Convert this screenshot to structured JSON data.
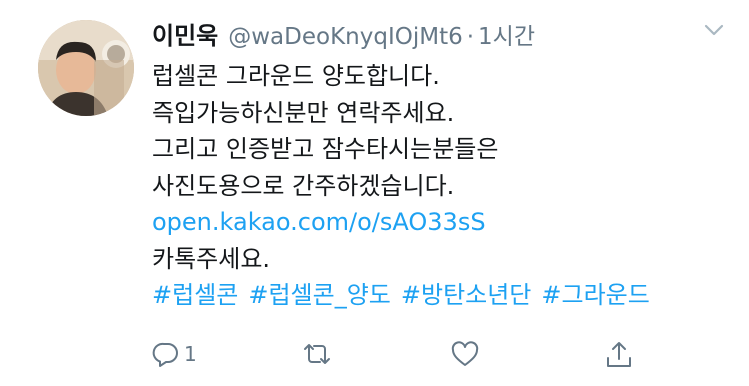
{
  "user": {
    "name": "이민욱",
    "handle": "@waDeoKnyqIOjMt6",
    "separator": "·",
    "time": "1시간"
  },
  "tweet": {
    "lines": [
      "럽셀콘 그라운드 양도합니다.",
      "즉입가능하신분만 연락주세요.",
      "그리고 인증받고 잠수타시는분들은",
      "사진도용으로 간주하겠습니다."
    ],
    "link": "open.kakao.com/o/sAO33sS",
    "closing": "카톡주세요.",
    "hashtags": [
      "#럽셀콘",
      "#럽셀콘_양도",
      "#방탄소년단",
      "#그라운드"
    ]
  },
  "actions": {
    "reply_count": "1"
  },
  "icons": {
    "more": "chevron-down-icon",
    "reply": "reply-icon",
    "retweet": "retweet-icon",
    "like": "heart-icon",
    "share": "share-icon"
  },
  "colors": {
    "link": "#1da1f2",
    "secondary": "#657786",
    "text": "#14171a"
  }
}
